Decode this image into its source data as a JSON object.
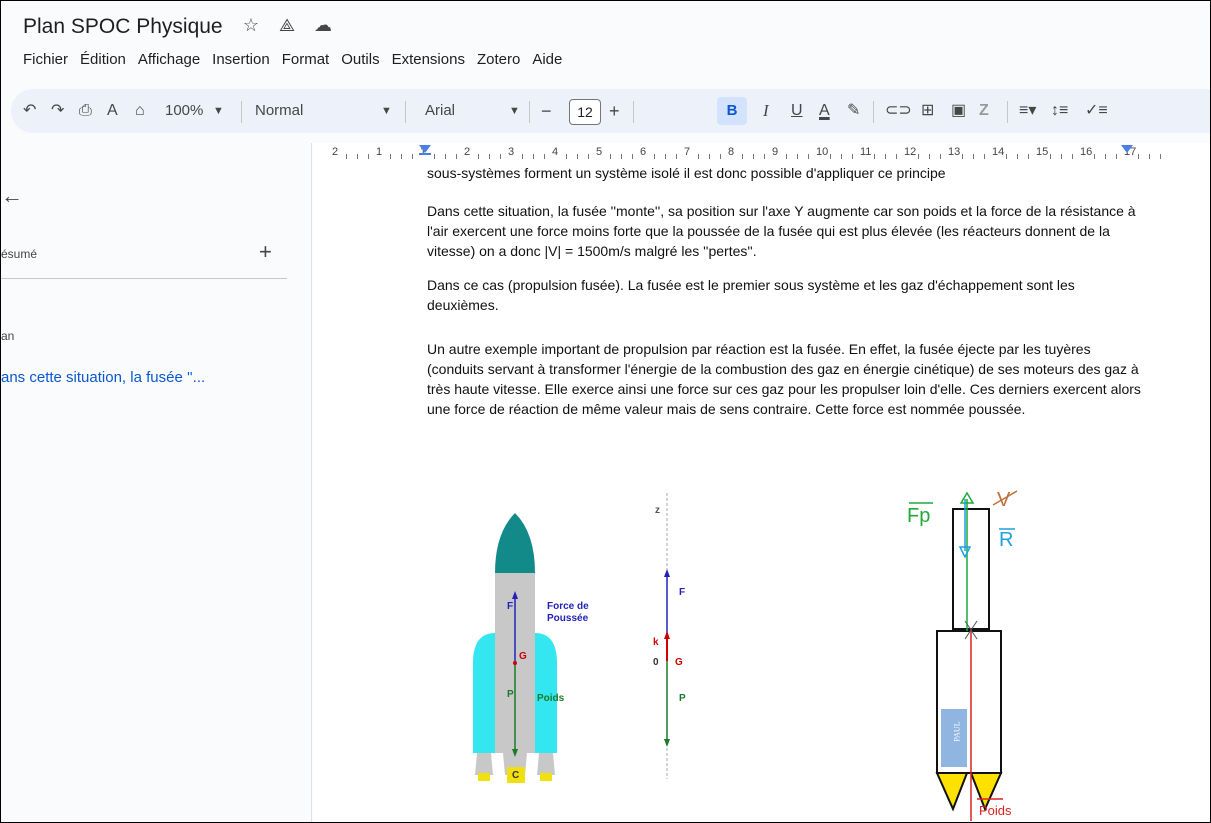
{
  "title": "Plan SPOC Physique",
  "title_icons": [
    "star-icon",
    "drive-move-icon",
    "cloud-saved-icon"
  ],
  "menu": [
    "Fichier",
    "Édition",
    "Affichage",
    "Insertion",
    "Format",
    "Outils",
    "Extensions",
    "Zotero",
    "Aide"
  ],
  "toolbar": {
    "zoom": "100%",
    "style": "Normal",
    "font": "Arial",
    "font_size": "12",
    "bold": "B",
    "italic": "I",
    "underline": "U",
    "text_color": "A",
    "minus": "−",
    "plus": "+"
  },
  "ruler": {
    "labels": [
      "2",
      "1",
      "1",
      "2",
      "3",
      "4",
      "5",
      "6",
      "7",
      "8",
      "9",
      "10",
      "11",
      "12",
      "13",
      "14",
      "15",
      "16",
      "17"
    ]
  },
  "sidebar": {
    "back_glyph": "←",
    "resume_label": "ésumé",
    "add_glyph": "+",
    "plan_label": "an",
    "outline_item": "ans cette situation, la fusée ''..."
  },
  "document": {
    "p1": "sous-systèmes forment un système isolé il est donc possible d'appliquer ce principe",
    "p2": "Dans cette situation, la fusée ''monte'', sa position sur l'axe Y augmente car son poids et la force de la résistance à l'air exercent une force moins forte que la poussée de la fusée qui est plus élevée (les réacteurs donnent de la vitesse) on a donc |V| = 1500m/s malgré les ''pertes''.",
    "p3": "Dans ce cas (propulsion fusée). La fusée est le premier sous système et les gaz d'échappement sont les deuxièmes.",
    "p4": "Un autre exemple important de propulsion par réaction est la fusée. En effet, la fusée éjecte par les tuyères (conduits servant à transformer l'énergie de la combustion des gaz en énergie cinétique) de ses moteurs des gaz à très haute vitesse. Elle exerce ainsi une force sur ces gaz pour les propulser loin d'elle. Ces derniers exercent alors une force de réaction de même valeur mais de sens contraire. Cette force est nommée poussée."
  },
  "figure1": {
    "force_label_1": "Force de",
    "force_label_2": "Poussée",
    "poids_label": "Poids",
    "F": "F",
    "G": "G",
    "P": "P",
    "C": "C"
  },
  "figure2": {
    "z": "z",
    "F": "F",
    "k": "k",
    "O": "0",
    "G": "G",
    "P": "P"
  },
  "figure3": {
    "Fp": "Fp",
    "V": "V",
    "R": "R",
    "paul": "PAUL",
    "poids": "Poids"
  },
  "colors": {
    "accent": "#0b57d0",
    "toolbar_bg": "#edf2fa",
    "rocket_nose": "#138a8a",
    "rocket_side": "#33e6f0",
    "rocket_body": "#c8c8c8",
    "flame": "#f0e010"
  }
}
